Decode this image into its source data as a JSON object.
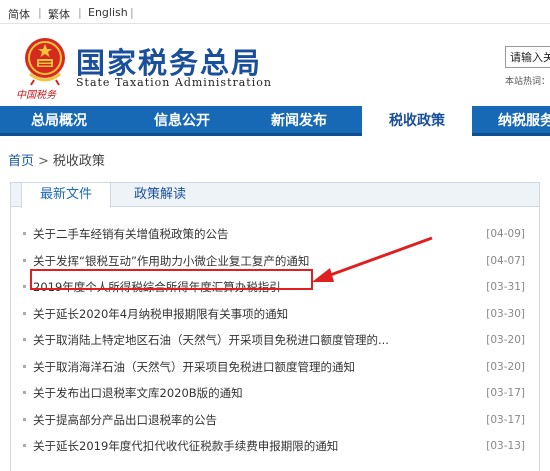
{
  "lang": {
    "simplified": "简体",
    "traditional": "繁体",
    "english": "English",
    "separator": "|"
  },
  "header": {
    "brand_cn": "中国税务",
    "title": "国家税务总局",
    "subtitle": "State Taxation Administration",
    "search_value": "请输入关",
    "hot_label": "本站热词："
  },
  "nav": {
    "items": [
      {
        "label": "总局概况",
        "active": false
      },
      {
        "label": "信息公开",
        "active": false
      },
      {
        "label": "新闻发布",
        "active": false
      },
      {
        "label": "税收政策",
        "active": true
      },
      {
        "label": "纳税服务",
        "active": false
      }
    ]
  },
  "breadcrumb": {
    "home": "首页",
    "arrow": ">",
    "current": "税收政策"
  },
  "tabs": [
    {
      "label": "最新文件",
      "active": true
    },
    {
      "label": "政策解读",
      "active": false
    }
  ],
  "list": [
    {
      "title": "关于二手车经销有关增值税政策的公告",
      "date": "[04-09]"
    },
    {
      "title": "关于发挥“银税互动”作用助力小微企业复工复产的通知",
      "date": "[04-07]"
    },
    {
      "title": "2019年度个人所得税综合所得年度汇算办税指引",
      "date": "[03-31]",
      "highlighted": true
    },
    {
      "title": "关于延长2020年4月纳税申报期限有关事项的通知",
      "date": "[03-30]"
    },
    {
      "title": "关于取消陆上特定地区石油（天然气）开采项目免税进口额度管理的...",
      "date": "[03-20]"
    },
    {
      "title": "关于取消海洋石油（天然气）开采项目免税进口额度管理的通知",
      "date": "[03-20]"
    },
    {
      "title": "关于发布出口退税率文库2020B版的通知",
      "date": "[03-17]"
    },
    {
      "title": "关于提高部分产品出口退税率的公告",
      "date": "[03-17]"
    },
    {
      "title": "关于延长2019年度代扣代收代征税款手续费申报期限的通知",
      "date": "[03-13]"
    }
  ],
  "colors": {
    "brand_blue": "#1a4f9c",
    "nav_blue": "#1869b5",
    "highlight_red": "#e02020"
  }
}
